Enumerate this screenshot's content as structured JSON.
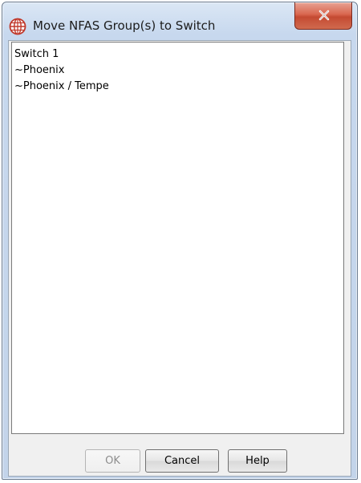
{
  "window": {
    "title": "Move NFAS Group(s) to Switch",
    "icon": "globe-icon",
    "accent_color": "#c0392b"
  },
  "titlebar": {
    "close_icon": "close-icon"
  },
  "list": {
    "items": [
      {
        "label": "Switch 1"
      },
      {
        "label": "~Phoenix"
      },
      {
        "label": "~Phoenix / Tempe"
      }
    ]
  },
  "buttons": {
    "ok_label": "OK",
    "ok_enabled": false,
    "cancel_label": "Cancel",
    "help_label": "Help"
  }
}
